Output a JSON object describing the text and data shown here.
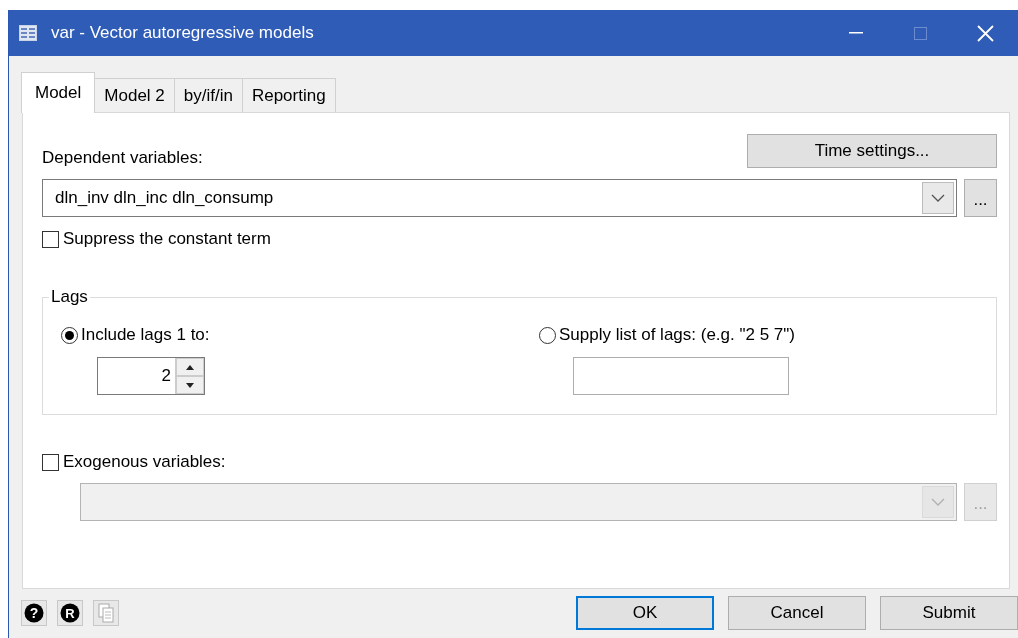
{
  "window": {
    "title": "var - Vector autoregressive models"
  },
  "tabs": [
    {
      "label": "Model",
      "selected": true
    },
    {
      "label": "Model 2",
      "selected": false
    },
    {
      "label": "by/if/in",
      "selected": false
    },
    {
      "label": "Reporting",
      "selected": false
    }
  ],
  "time_settings_button": "Time settings...",
  "dependent_variables": {
    "label": "Dependent variables:",
    "value": "dln_inv dln_inc dln_consump",
    "browse": "..."
  },
  "suppress_constant": {
    "label": "Suppress the constant term",
    "checked": false
  },
  "lags": {
    "title": "Lags",
    "options": [
      {
        "kind": "spinner",
        "label": "Include lags 1 to:",
        "selected": true,
        "value": "2"
      },
      {
        "kind": "text",
        "label": "Supply list of lags: (e.g. \"2 5 7\")",
        "selected": false
      }
    ]
  },
  "exogenous_variables": {
    "label": "Exogenous variables:",
    "checked": false,
    "browse": "..."
  },
  "footer_icons": [
    {
      "kind": "help",
      "glyph": "?"
    },
    {
      "kind": "badge",
      "glyph": "R"
    },
    {
      "kind": "copy"
    }
  ],
  "buttons": [
    {
      "label": "OK",
      "default": true
    },
    {
      "label": "Cancel",
      "default": false
    },
    {
      "label": "Submit",
      "default": false
    }
  ]
}
